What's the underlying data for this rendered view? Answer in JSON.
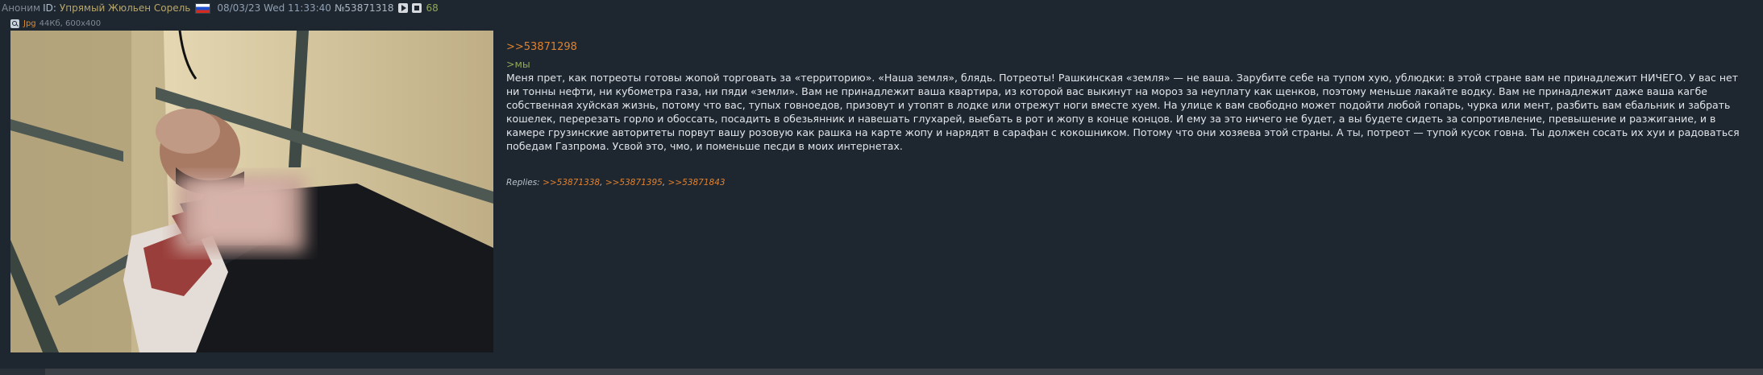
{
  "post": {
    "anon_label": "Аноним",
    "id_label": "ID:",
    "nickname": "Упрямый Жюльен Сорель",
    "datetime": "08/03/23 Wed 11:33:40",
    "number": "№53871318",
    "reply_count": "68",
    "file": {
      "ext": "Jpg",
      "meta": "44Кб, 600x400"
    },
    "reply_to": ">>53871298",
    "quote": ">мы",
    "message": "Меня прет, как потреоты готовы жопой торговать за «территорию». «Наша земля», блядь. Потреоты! Рашкинская «земля» — не ваша. Зарубите себе на тупом хую, ублюдки: в этой стране вам не принадлежит НИЧЕГО. У вас нет ни тонны нефти, ни кубометра газа, ни пяди «земли». Вам не принадлежит ваша квартира, из которой вас выкинут на мороз за неуплату как щенков, поэтому меньше лакайте водку. Вам не принадлежит даже ваша кагбе собственная хуйская жизнь, потому что вас, тупых говноедов, призовут и утопят в лодке или отрежут ноги вместе хуем. На улице к вам свободно может подойти любой гопарь, чурка или мент, разбить вам ебальник и забрать кошелек, перерезать горло и обоссать, посадить в обезьянник и навешать глухарей, выебать в рот и жопу в конце концов. И ему за это ничего не будет, а вы будете сидеть за сопротивление, превышение и разжигание, и в камере грузинские авторитеты порвут вашу розовую как рашка на карте жопу и нарядят в сарафан с кокошником. Потому что они хозяева этой страны. А ты, потреот — тупой кусок говна. Ты должен сосать их хуи и радоваться победам Газпрома. Усвой это, чмо, и поменьше песди в моих интернетах.",
    "replies_label": "Replies:",
    "replies": [
      ">>53871338",
      ">>53871395",
      ">>53871843"
    ],
    "icons": {
      "flag": "russia-flag-icon",
      "play": "play-icon",
      "stop": "stop-icon",
      "search": "search-icon"
    }
  }
}
